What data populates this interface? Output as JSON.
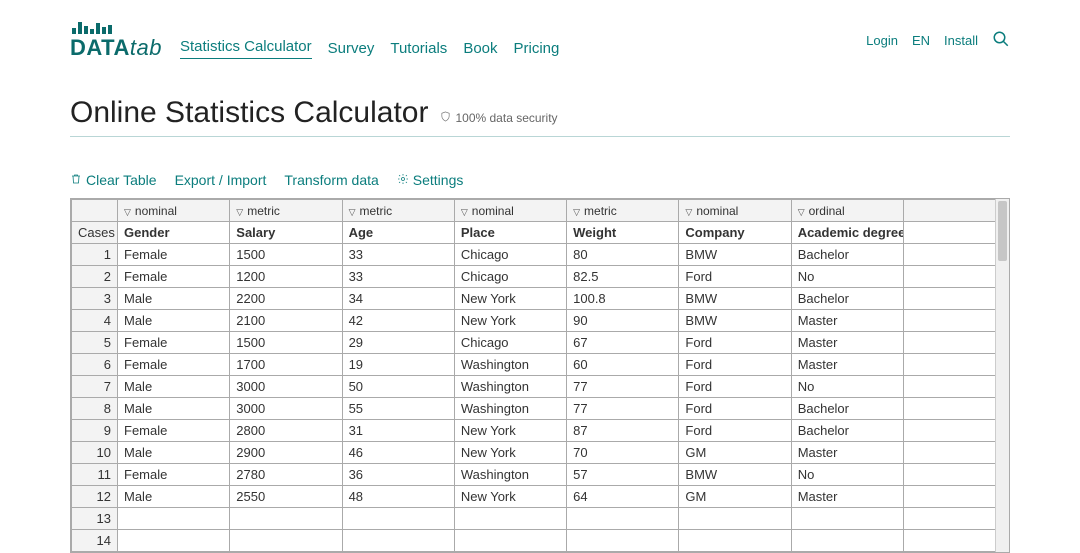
{
  "logo": {
    "main": "DATA",
    "sub": "tab"
  },
  "nav": {
    "items": [
      {
        "label": "Statistics Calculator",
        "active": true
      },
      {
        "label": "Survey"
      },
      {
        "label": "Tutorials"
      },
      {
        "label": "Book"
      },
      {
        "label": "Pricing"
      }
    ]
  },
  "header_right": {
    "login": "Login",
    "lang": "EN",
    "install": "Install"
  },
  "title": "Online Statistics Calculator",
  "security_label": "100% data security",
  "toolbar": {
    "clear": "Clear Table",
    "export": "Export / Import",
    "transform": "Transform data",
    "settings": "Settings"
  },
  "table": {
    "cases_label": "Cases",
    "columns": [
      {
        "type": "nominal",
        "name": "Gender"
      },
      {
        "type": "metric",
        "name": "Salary"
      },
      {
        "type": "metric",
        "name": "Age"
      },
      {
        "type": "nominal",
        "name": "Place"
      },
      {
        "type": "metric",
        "name": "Weight"
      },
      {
        "type": "nominal",
        "name": "Company"
      },
      {
        "type": "ordinal",
        "name": "Academic degree"
      }
    ],
    "rows": [
      [
        "Female",
        "1500",
        "33",
        "Chicago",
        "80",
        "BMW",
        "Bachelor"
      ],
      [
        "Female",
        "1200",
        "33",
        "Chicago",
        "82.5",
        "Ford",
        "No"
      ],
      [
        "Male",
        "2200",
        "34",
        "New York",
        "100.8",
        "BMW",
        "Bachelor"
      ],
      [
        "Male",
        "2100",
        "42",
        "New York",
        "90",
        "BMW",
        "Master"
      ],
      [
        "Female",
        "1500",
        "29",
        "Chicago",
        "67",
        "Ford",
        "Master"
      ],
      [
        "Female",
        "1700",
        "19",
        "Washington",
        "60",
        "Ford",
        "Master"
      ],
      [
        "Male",
        "3000",
        "50",
        "Washington",
        "77",
        "Ford",
        "No"
      ],
      [
        "Male",
        "3000",
        "55",
        "Washington",
        "77",
        "Ford",
        "Bachelor"
      ],
      [
        "Female",
        "2800",
        "31",
        "New York",
        "87",
        "Ford",
        "Bachelor"
      ],
      [
        "Male",
        "2900",
        "46",
        "New York",
        "70",
        "GM",
        "Master"
      ],
      [
        "Female",
        "2780",
        "36",
        "Washington",
        "57",
        "BMW",
        "No"
      ],
      [
        "Male",
        "2550",
        "48",
        "New York",
        "64",
        "GM",
        "Master"
      ]
    ],
    "empty_rows": 2
  }
}
